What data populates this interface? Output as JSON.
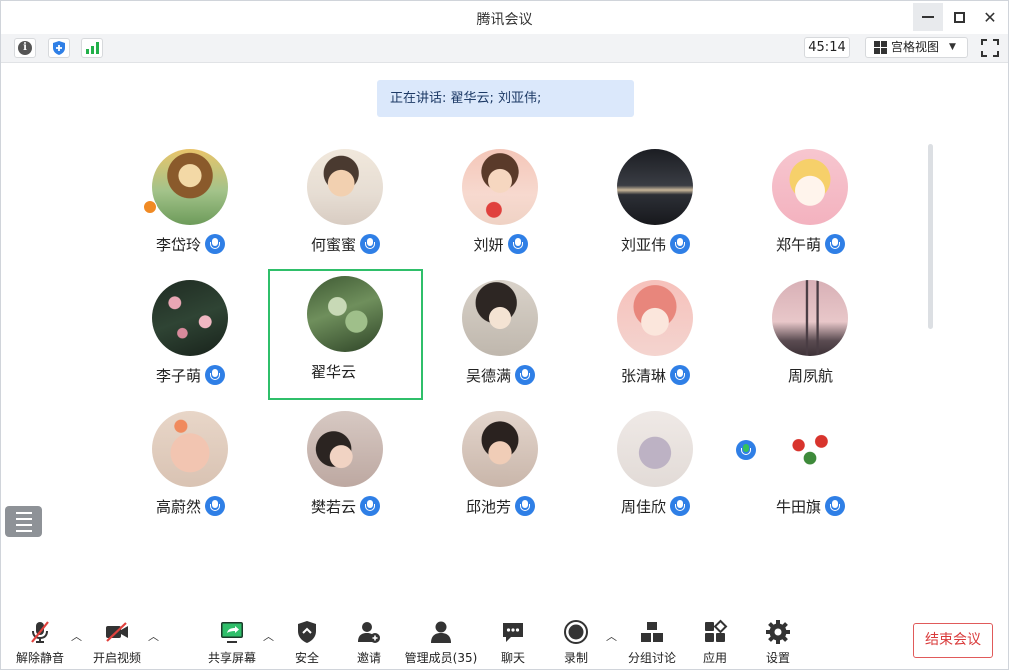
{
  "window": {
    "title": "腾讯会议"
  },
  "topbar": {
    "timer": "45:14",
    "view_label": "宫格视图"
  },
  "speaking_banner": "正在讲话: 翟华云; 刘亚伟;",
  "participants": [
    {
      "name": "李岱玲",
      "mic": "on",
      "host": true
    },
    {
      "name": "何蜜蜜",
      "mic": "on"
    },
    {
      "name": "刘妍",
      "mic": "on"
    },
    {
      "name": "刘亚伟",
      "mic": "on"
    },
    {
      "name": "郑午萌",
      "mic": "on"
    },
    {
      "name": "李子萌",
      "mic": "on"
    },
    {
      "name": "翟华云",
      "mic": "speaking",
      "active": true
    },
    {
      "name": "吴德满",
      "mic": "on"
    },
    {
      "name": "张清琳",
      "mic": "on"
    },
    {
      "name": "周夙航",
      "mic": "none"
    },
    {
      "name": "高蔚然",
      "mic": "on"
    },
    {
      "name": "樊若云",
      "mic": "on"
    },
    {
      "name": "邱池芳",
      "mic": "on"
    },
    {
      "name": "周佳欣",
      "mic": "on"
    },
    {
      "name": "牛田旗",
      "mic": "on"
    }
  ],
  "bottombar": {
    "unmute": "解除静音",
    "start_video": "开启视频",
    "share_screen": "共享屏幕",
    "security": "安全",
    "invite": "邀请",
    "manage_members": "管理成员(35)",
    "chat": "聊天",
    "record": "录制",
    "breakout": "分组讨论",
    "apps": "应用",
    "settings": "设置",
    "end_meeting": "结束会议"
  },
  "colors": {
    "accent": "#2f7fe6",
    "speaking": "#36c25a",
    "active_border": "#2fbf6a",
    "end_red": "#d93b3b"
  }
}
